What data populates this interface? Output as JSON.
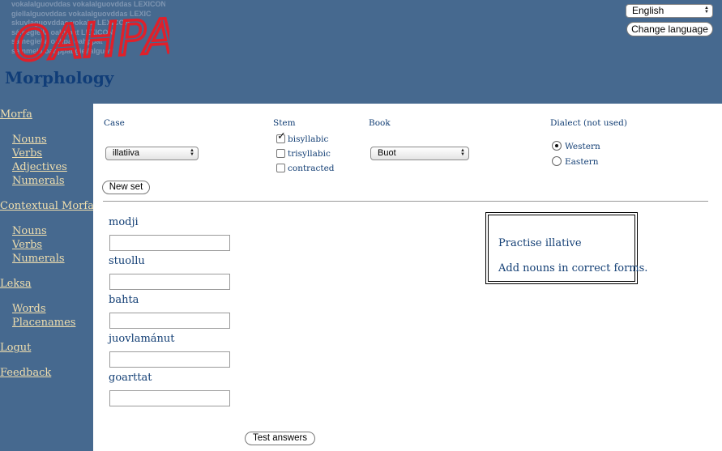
{
  "header": {
    "logo_text": "OAHPA!",
    "logo_background_lines": [
      "vokalalguovddas vokalalguovddas LEXICON",
      "giellalguovddas vokalalguovddas LEXIC",
      "skuvlaguovddas vokalal LEXICON",
      "sámegiella oahppat LEXICON",
      "sámegiella oahpa oahppat",
      "semmela oahppat giellalguov"
    ],
    "page_title": "Morphology",
    "language_select": "English",
    "change_language_button": "Change language"
  },
  "sidebar": {
    "items": [
      {
        "label": "Morfa"
      },
      {
        "label": "Nouns"
      },
      {
        "label": "Verbs"
      },
      {
        "label": "Adjectives"
      },
      {
        "label": "Numerals"
      },
      {
        "label": "Contextual Morfa"
      },
      {
        "label": "Nouns"
      },
      {
        "label": "Verbs"
      },
      {
        "label": "Numerals"
      },
      {
        "label": "Leksa"
      },
      {
        "label": "Words"
      },
      {
        "label": "Placenames"
      },
      {
        "label": "Logut"
      },
      {
        "label": "Feedback"
      }
    ]
  },
  "settings": {
    "case": {
      "label": "Case",
      "value": "illatiiva"
    },
    "stem": {
      "label": "Stem",
      "options": [
        {
          "label": "bisyllabic",
          "checked": true
        },
        {
          "label": "trisyllabic",
          "checked": false
        },
        {
          "label": "contracted",
          "checked": false
        }
      ]
    },
    "book": {
      "label": "Book",
      "value": "Buot"
    },
    "dialect": {
      "label": "Dialect (not used)",
      "options": [
        {
          "label": "Western",
          "selected": true
        },
        {
          "label": "Eastern",
          "selected": false
        }
      ]
    },
    "new_set_button": "New set"
  },
  "exercise": {
    "words": [
      {
        "word": "modji",
        "answer": ""
      },
      {
        "word": "stuollu",
        "answer": ""
      },
      {
        "word": "bahta",
        "answer": ""
      },
      {
        "word": "juovlamánut",
        "answer": ""
      },
      {
        "word": "goarttat",
        "answer": ""
      }
    ],
    "test_button": "Test answers"
  },
  "info": {
    "line1": "Practise illative",
    "line2": "Add nouns in correct forms."
  },
  "colors": {
    "background": "#46698f",
    "link": "#f1dfae",
    "title": "#103d78",
    "logo": "#e0202a"
  }
}
